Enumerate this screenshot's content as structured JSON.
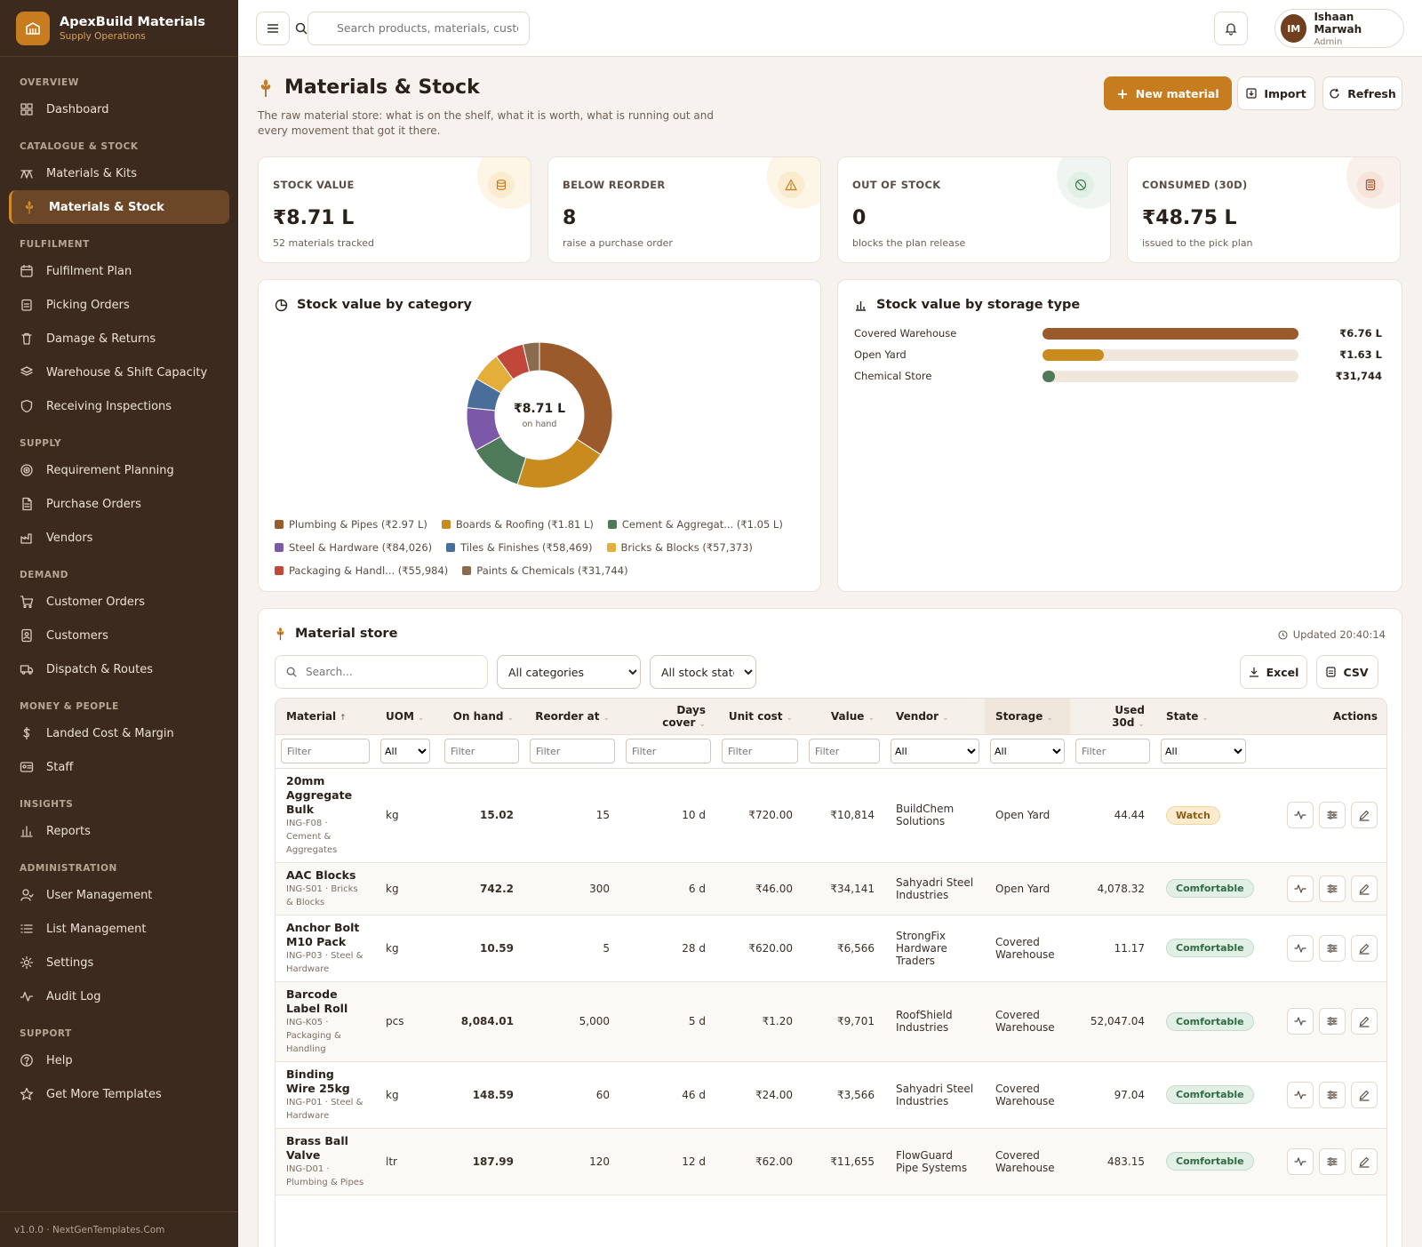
{
  "brand": {
    "name": "ApexBuild Materials",
    "subtitle": "Supply Operations"
  },
  "sidebar": {
    "sections": [
      {
        "title": "OVERVIEW",
        "items": [
          {
            "label": "Dashboard",
            "icon": "grid-icon"
          }
        ]
      },
      {
        "title": "CATALOGUE & STOCK",
        "items": [
          {
            "label": "Materials & Kits",
            "icon": "scale-icon"
          },
          {
            "label": "Materials & Stock",
            "icon": "wheat-icon",
            "active": true
          }
        ]
      },
      {
        "title": "FULFILMENT",
        "items": [
          {
            "label": "Fulfilment Plan",
            "icon": "calendar-icon"
          },
          {
            "label": "Picking Orders",
            "icon": "clipboard-icon"
          },
          {
            "label": "Damage & Returns",
            "icon": "trash-icon"
          },
          {
            "label": "Warehouse & Shift Capacity",
            "icon": "layers-icon"
          },
          {
            "label": "Receiving Inspections",
            "icon": "shield-icon"
          }
        ]
      },
      {
        "title": "SUPPLY",
        "items": [
          {
            "label": "Requirement Planning",
            "icon": "target-icon"
          },
          {
            "label": "Purchase Orders",
            "icon": "document-icon"
          },
          {
            "label": "Vendors",
            "icon": "factory-icon"
          }
        ]
      },
      {
        "title": "DEMAND",
        "items": [
          {
            "label": "Customer Orders",
            "icon": "cart-icon"
          },
          {
            "label": "Customers",
            "icon": "contacts-icon"
          },
          {
            "label": "Dispatch & Routes",
            "icon": "truck-icon"
          }
        ]
      },
      {
        "title": "MONEY & PEOPLE",
        "items": [
          {
            "label": "Landed Cost & Margin",
            "icon": "dollar-icon"
          },
          {
            "label": "Staff",
            "icon": "id-card-icon"
          }
        ]
      },
      {
        "title": "INSIGHTS",
        "items": [
          {
            "label": "Reports",
            "icon": "bar-chart-icon"
          }
        ]
      },
      {
        "title": "ADMINISTRATION",
        "items": [
          {
            "label": "User Management",
            "icon": "user-icon"
          },
          {
            "label": "List Management",
            "icon": "list-icon"
          },
          {
            "label": "Settings",
            "icon": "gear-icon"
          },
          {
            "label": "Audit Log",
            "icon": "activity-icon"
          }
        ]
      },
      {
        "title": "SUPPORT",
        "items": [
          {
            "label": "Help",
            "icon": "help-icon"
          },
          {
            "label": "Get More Templates",
            "icon": "star-icon"
          }
        ]
      }
    ],
    "footer": "v1.0.0 · NextGenTemplates.Com"
  },
  "topbar": {
    "search_placeholder": "Search products, materials, customers",
    "user": {
      "initials": "IM",
      "name": "Ishaan Marwah",
      "role": "Admin"
    }
  },
  "page": {
    "title": "Materials & Stock",
    "description": "The raw material store: what is on the shelf, what it is worth, what is running out and every movement that got it there.",
    "buttons": {
      "new": "New material",
      "import": "Import",
      "refresh": "Refresh"
    }
  },
  "kpis": [
    {
      "label": "STOCK VALUE",
      "value": "₹8.71 L",
      "sub": "52 materials tracked",
      "icon": "database-icon",
      "color": "#c77d1f",
      "bg": "#fbecd0"
    },
    {
      "label": "BELOW REORDER",
      "value": "8",
      "sub": "raise a purchase order",
      "icon": "warning-icon",
      "color": "#c77d1f",
      "bg": "#fbecd0"
    },
    {
      "label": "OUT OF STOCK",
      "value": "0",
      "sub": "blocks the plan release",
      "icon": "ban-icon",
      "color": "#3b7a55",
      "bg": "#e2efe5"
    },
    {
      "label": "CONSUMED (30D)",
      "value": "₹48.75 L",
      "sub": "issued to the pick plan",
      "icon": "calculator-icon",
      "color": "#a0522d",
      "bg": "#f6e3da"
    }
  ],
  "category_chart": {
    "title": "Stock value by category",
    "center_value": "₹8.71 L",
    "center_label": "on hand",
    "chart_data": {
      "type": "pie",
      "categories": [
        "Plumbing & Pipes",
        "Boards & Roofing",
        "Cement & Aggregat...",
        "Steel & Hardware",
        "Tiles & Finishes",
        "Bricks & Blocks",
        "Packaging & Handl...",
        "Paints & Chemicals"
      ],
      "values": [
        297000,
        181000,
        105000,
        84026,
        58469,
        57373,
        55984,
        31744
      ],
      "legend_labels": [
        "Plumbing & Pipes (₹2.97 L)",
        "Boards & Roofing (₹1.81 L)",
        "Cement & Aggregat... (₹1.05 L)",
        "Steel & Hardware (₹84,026)",
        "Tiles & Finishes (₹58,469)",
        "Bricks & Blocks (₹57,373)",
        "Packaging & Handl... (₹55,984)",
        "Paints & Chemicals (₹31,744)"
      ],
      "colors": [
        "#9b5a2c",
        "#c98a1e",
        "#4e7a5a",
        "#7b58a8",
        "#4a6e9a",
        "#e3ae3a",
        "#c0473a",
        "#8a6b4e"
      ]
    }
  },
  "storage_chart": {
    "title": "Stock value by storage type",
    "chart_data": {
      "type": "bar",
      "categories": [
        "Covered Warehouse",
        "Open Yard",
        "Chemical Store"
      ],
      "values": [
        676000,
        163000,
        31744
      ],
      "value_labels": [
        "₹6.76 L",
        "₹1.63 L",
        "₹31,744"
      ],
      "colors": [
        "#9b5a2c",
        "#c98a1e",
        "#4e7a5a"
      ]
    }
  },
  "store": {
    "title": "Material store",
    "updated": "Updated 20:40:14",
    "search_placeholder": "Search...",
    "category_filter": "All categories",
    "state_filter": "All stock states",
    "excel": "Excel",
    "csv": "CSV",
    "filter_placeholder": "Filter",
    "all": "All",
    "columns": [
      "Material",
      "UOM",
      "On hand",
      "Reorder at",
      "Days cover",
      "Unit cost",
      "Value",
      "Vendor",
      "Storage",
      "Used 30d",
      "State",
      "Actions"
    ],
    "rows": [
      {
        "name": "20mm Aggregate Bulk",
        "meta": "ING-F08 · Cement & Aggregates",
        "uom": "kg",
        "on_hand": "15.02",
        "reorder": "15",
        "cover": "10 d",
        "unit_cost": "₹720.00",
        "value": "₹10,814",
        "vendor": "BuildChem Solutions",
        "storage": "Open Yard",
        "used": "44.44",
        "state": "Watch"
      },
      {
        "name": "AAC Blocks",
        "meta": "ING-S01 · Bricks & Blocks",
        "uom": "kg",
        "on_hand": "742.2",
        "reorder": "300",
        "cover": "6 d",
        "unit_cost": "₹46.00",
        "value": "₹34,141",
        "vendor": "Sahyadri Steel Industries",
        "storage": "Open Yard",
        "used": "4,078.32",
        "state": "Comfortable"
      },
      {
        "name": "Anchor Bolt M10 Pack",
        "meta": "ING-P03 · Steel & Hardware",
        "uom": "kg",
        "on_hand": "10.59",
        "reorder": "5",
        "cover": "28 d",
        "unit_cost": "₹620.00",
        "value": "₹6,566",
        "vendor": "StrongFix Hardware Traders",
        "storage": "Covered Warehouse",
        "used": "11.17",
        "state": "Comfortable"
      },
      {
        "name": "Barcode Label Roll",
        "meta": "ING-K05 · Packaging & Handling",
        "uom": "pcs",
        "on_hand": "8,084.01",
        "reorder": "5,000",
        "cover": "5 d",
        "unit_cost": "₹1.20",
        "value": "₹9,701",
        "vendor": "RoofShield Industries",
        "storage": "Covered Warehouse",
        "used": "52,047.04",
        "state": "Comfortable"
      },
      {
        "name": "Binding Wire 25kg",
        "meta": "ING-P01 · Steel & Hardware",
        "uom": "kg",
        "on_hand": "148.59",
        "reorder": "60",
        "cover": "46 d",
        "unit_cost": "₹24.00",
        "value": "₹3,566",
        "vendor": "Sahyadri Steel Industries",
        "storage": "Covered Warehouse",
        "used": "97.04",
        "state": "Comfortable"
      },
      {
        "name": "Brass Ball Valve",
        "meta": "ING-D01 · Plumbing & Pipes",
        "uom": "ltr",
        "on_hand": "187.99",
        "reorder": "120",
        "cover": "12 d",
        "unit_cost": "₹62.00",
        "value": "₹11,655",
        "vendor": "FlowGuard Pipe Systems",
        "storage": "Covered Warehouse",
        "used": "483.15",
        "state": "Comfortable"
      }
    ]
  }
}
